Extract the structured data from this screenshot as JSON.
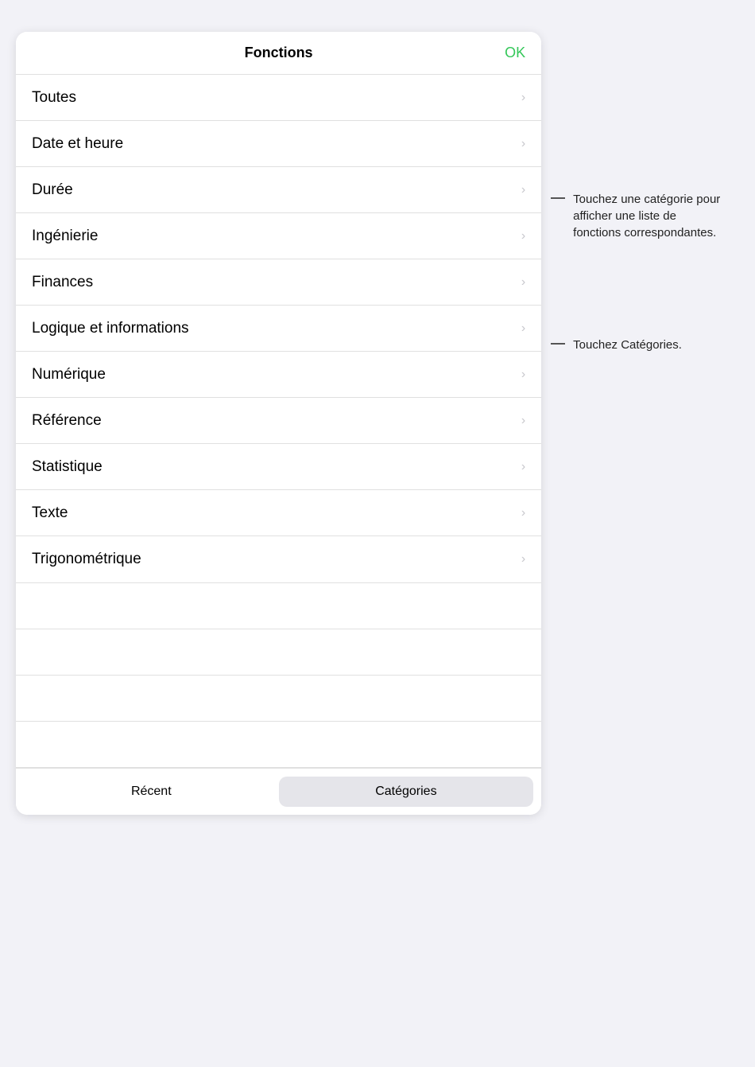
{
  "header": {
    "title": "Fonctions",
    "ok_label": "OK"
  },
  "list_items": [
    {
      "id": "toutes",
      "label": "Toutes"
    },
    {
      "id": "date-et-heure",
      "label": "Date et heure"
    },
    {
      "id": "duree",
      "label": "Durée"
    },
    {
      "id": "ingenierie",
      "label": "Ingénierie"
    },
    {
      "id": "finances",
      "label": "Finances"
    },
    {
      "id": "logique-et-informations",
      "label": "Logique et informations"
    },
    {
      "id": "numerique",
      "label": "Numérique"
    },
    {
      "id": "reference",
      "label": "Référence"
    },
    {
      "id": "statistique",
      "label": "Statistique"
    },
    {
      "id": "texte",
      "label": "Texte"
    },
    {
      "id": "trigonometrique",
      "label": "Trigonométrique"
    }
  ],
  "tabs": [
    {
      "id": "recent",
      "label": "Récent",
      "active": false
    },
    {
      "id": "categories",
      "label": "Catégories",
      "active": true
    }
  ],
  "annotations": [
    {
      "id": "annotation-categories",
      "text": "Touchez une catégorie pour afficher une liste de fonctions correspondantes."
    },
    {
      "id": "annotation-bottom",
      "text": "Touchez Catégories."
    }
  ],
  "chevron": "›"
}
